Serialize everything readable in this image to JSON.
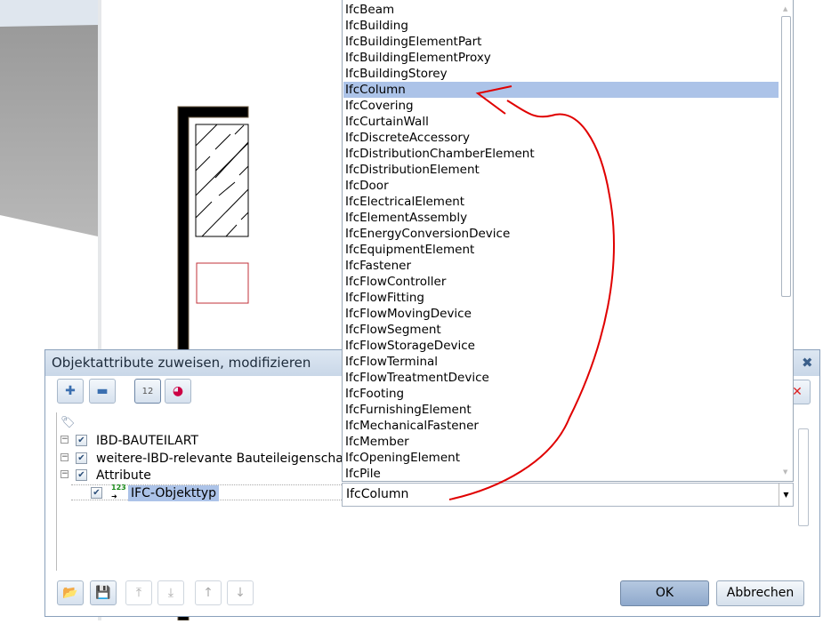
{
  "dialog": {
    "title": "Objektattribute zuweisen, modifizieren",
    "close_icon": "close-icon",
    "toolbar": [
      {
        "name": "add-button",
        "icon": "plus-icon"
      },
      {
        "name": "remove-button",
        "icon": "minus-icon"
      },
      {
        "name": "show-numbers-button",
        "icon": "number-eye-icon"
      },
      {
        "name": "show-colors-button",
        "icon": "color-eye-icon"
      }
    ],
    "tree": {
      "items": [
        {
          "label": "IBD-BAUTEILART",
          "checked": true,
          "expanded": true
        },
        {
          "label": "weitere-IBD-relevante Bauteileigenschaften",
          "checked": true,
          "expanded": true
        },
        {
          "label": "Attribute",
          "checked": true,
          "expanded": true
        },
        {
          "label": "IFC-Objekttyp",
          "checked": true,
          "selected": true,
          "icon": "number-attribute-icon"
        }
      ]
    },
    "combo_value": "IfcColumn",
    "ok_label": "OK",
    "cancel_label": "Abbrechen"
  },
  "dropdown": {
    "selected": "IfcColumn",
    "options": [
      "IfcBeam",
      "IfcBuilding",
      "IfcBuildingElementPart",
      "IfcBuildingElementProxy",
      "IfcBuildingStorey",
      "IfcColumn",
      "IfcCovering",
      "IfcCurtainWall",
      "IfcDiscreteAccessory",
      "IfcDistributionChamberElement",
      "IfcDistributionElement",
      "IfcDoor",
      "IfcElectricalElement",
      "IfcElementAssembly",
      "IfcEnergyConversionDevice",
      "IfcEquipmentElement",
      "IfcFastener",
      "IfcFlowController",
      "IfcFlowFitting",
      "IfcFlowMovingDevice",
      "IfcFlowSegment",
      "IfcFlowStorageDevice",
      "IfcFlowTerminal",
      "IfcFlowTreatmentDevice",
      "IfcFooting",
      "IfcFurnishingElement",
      "IfcMechanicalFastener",
      "IfcMember",
      "IfcOpeningElement",
      "IfcPile"
    ]
  },
  "colors": {
    "selection": "#acc3e8",
    "annotation": "#e00000",
    "title_bar": "#c9d7e8"
  }
}
